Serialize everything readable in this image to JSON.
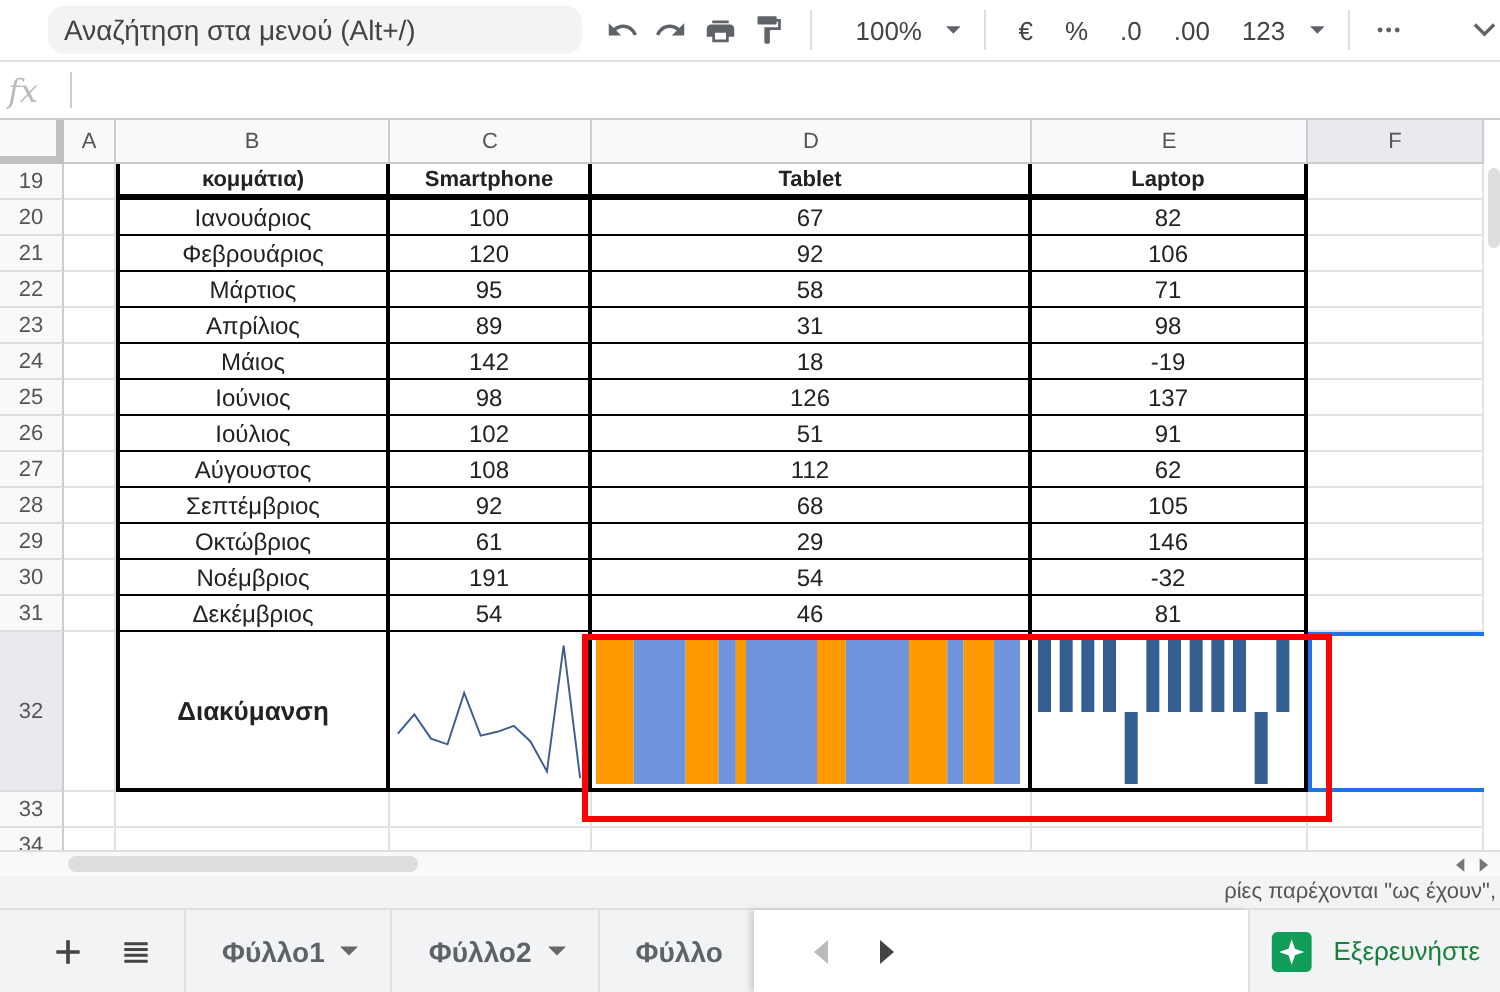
{
  "search": {
    "placeholder": "Αναζήτηση στα μενού (Alt+/)"
  },
  "toolbar": {
    "zoom": "100%",
    "currency": "€",
    "percent": "%",
    "decrease_decimals": ".0",
    "increase_decimals": ".00",
    "format": "123"
  },
  "formula_bar": {
    "label": "fx"
  },
  "columns": [
    "A",
    "B",
    "C",
    "D",
    "E",
    "F"
  ],
  "header_row": {
    "number": "19",
    "cells": [
      "κομμάτια)",
      "Smartphone",
      "Tablet",
      "Laptop"
    ]
  },
  "rows": [
    {
      "number": "20",
      "month": "Ιανουάριος",
      "values": [
        "100",
        "67",
        "82"
      ]
    },
    {
      "number": "21",
      "month": "Φεβρουάριος",
      "values": [
        "120",
        "92",
        "106"
      ]
    },
    {
      "number": "22",
      "month": "Μάρτιος",
      "values": [
        "95",
        "58",
        "71"
      ]
    },
    {
      "number": "23",
      "month": "Απρίλιος",
      "values": [
        "89",
        "31",
        "98"
      ]
    },
    {
      "number": "24",
      "month": "Μάιος",
      "values": [
        "142",
        "18",
        "-19"
      ]
    },
    {
      "number": "25",
      "month": "Ιούνιος",
      "values": [
        "98",
        "126",
        "137"
      ]
    },
    {
      "number": "26",
      "month": "Ιούλιος",
      "values": [
        "102",
        "51",
        "91"
      ]
    },
    {
      "number": "27",
      "month": "Αύγουστος",
      "values": [
        "108",
        "112",
        "62"
      ]
    },
    {
      "number": "28",
      "month": "Σεπτέμβριος",
      "values": [
        "92",
        "68",
        "105"
      ]
    },
    {
      "number": "29",
      "month": "Οκτώβριος",
      "values": [
        "61",
        "29",
        "146"
      ]
    },
    {
      "number": "30",
      "month": "Νοέμβριος",
      "values": [
        "191",
        "54",
        "-32"
      ]
    },
    {
      "number": "31",
      "month": "Δεκέμβριος",
      "values": [
        "54",
        "46",
        "81"
      ]
    }
  ],
  "summary_row": {
    "number": "32",
    "label": "Διακύμανση"
  },
  "empty_rows": [
    "33",
    "34"
  ],
  "notice": "ρίες παρέχονται \"ως έχουν\",",
  "sheets": [
    {
      "name": "Φύλλο1",
      "selected": false
    },
    {
      "name": "Φύλλο2",
      "selected": false
    },
    {
      "name": "Φύλλο",
      "selected": false
    }
  ],
  "explore": {
    "label": "Εξερευνήστε"
  }
}
